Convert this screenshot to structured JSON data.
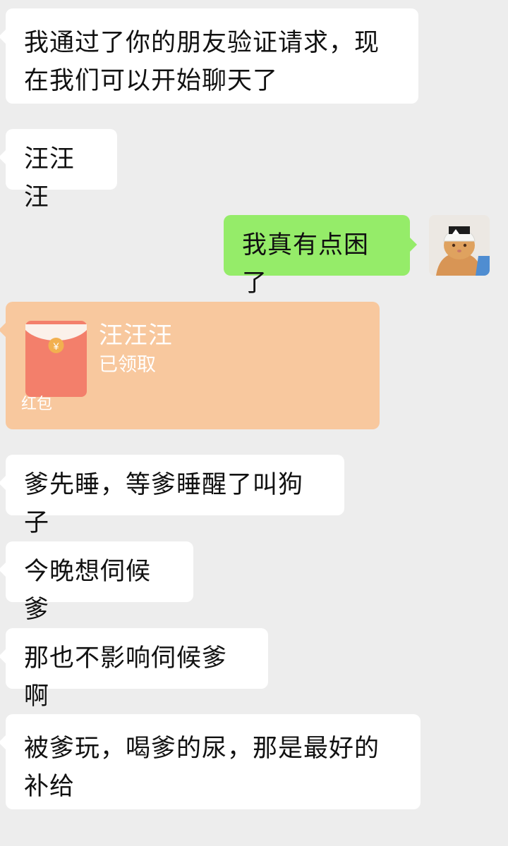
{
  "messages": {
    "m1": "我通过了你的朋友验证请求，现在我们可以开始聊天了",
    "m2": "汪汪汪",
    "m3": "我真有点困了",
    "m5": "爹先睡，等爹睡醒了叫狗子",
    "m6": "今晚想伺候爹",
    "m7": "那也不影响伺候爹啊",
    "m8": "被爹玩，喝爹的尿，那是最好的补给"
  },
  "red_packet": {
    "sender": "汪汪汪",
    "status": "已领取",
    "label": "红包",
    "symbol": "¥",
    "background_color": "#f8c89e"
  },
  "avatar": {
    "icon": "cat-avatar-icon"
  },
  "colors": {
    "chat_background": "#ededed",
    "incoming_bubble": "#ffffff",
    "outgoing_bubble": "#95ec69"
  }
}
